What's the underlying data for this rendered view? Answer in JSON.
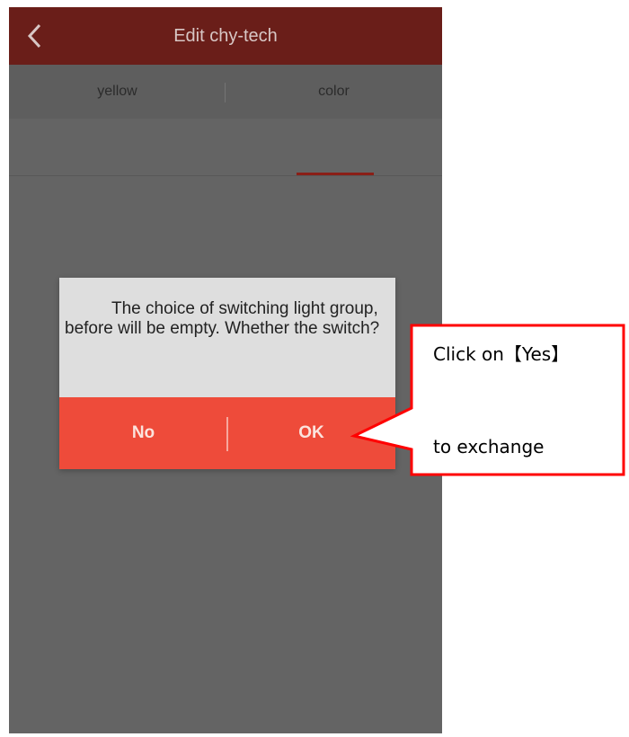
{
  "header": {
    "title": "Edit chy-tech",
    "back_icon": "chevron-left-icon"
  },
  "tabs": [
    {
      "label": "yellow",
      "selected": false
    },
    {
      "label": "color",
      "selected": true
    }
  ],
  "dialog": {
    "message": "The choice of switching light group, before will be empty. Whether the switch?",
    "no_label": "No",
    "ok_label": "OK"
  },
  "callout": {
    "line1": "Click on【Yes】",
    "line2": "to exchange",
    "border_color": "#ff0000"
  },
  "colors": {
    "appbar": "#6a1e19",
    "overlay": "#646464",
    "dialog_button_bar": "#ee4b3a"
  }
}
